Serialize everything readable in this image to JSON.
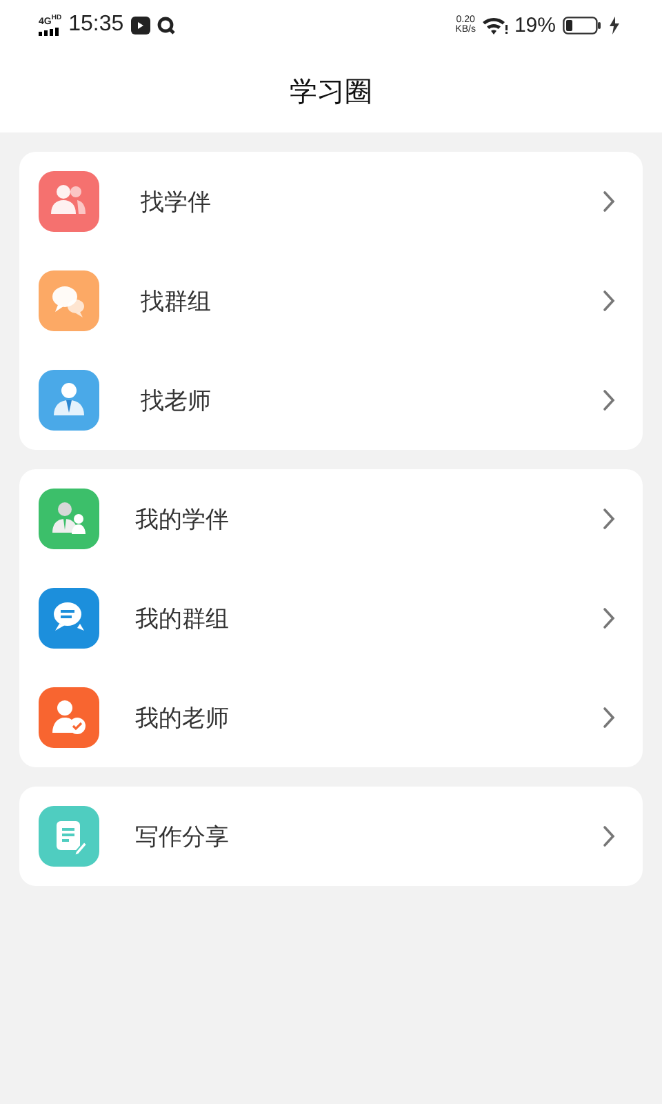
{
  "status_bar": {
    "network": "4G",
    "network_sub": "HD",
    "time": "15:35",
    "speed": "0.20",
    "speed_unit": "KB/s",
    "battery": "19%"
  },
  "header": {
    "title": "学习圈"
  },
  "groups": [
    {
      "items": [
        {
          "label": "找学伴",
          "kind": "people",
          "color": "#f5716f"
        },
        {
          "label": "找群组",
          "kind": "chat",
          "color": "#fca965"
        },
        {
          "label": "找老师",
          "kind": "teacher",
          "color": "#4aa9e8"
        }
      ]
    },
    {
      "items": [
        {
          "label": "我的学伴",
          "kind": "pair",
          "color": "#3cbf6a"
        },
        {
          "label": "我的群组",
          "kind": "message",
          "color": "#1c8fdc"
        },
        {
          "label": "我的老师",
          "kind": "verified",
          "color": "#f86530"
        }
      ]
    },
    {
      "items": [
        {
          "label": "写作分享",
          "kind": "note",
          "color": "#4fcdc0"
        }
      ]
    }
  ]
}
